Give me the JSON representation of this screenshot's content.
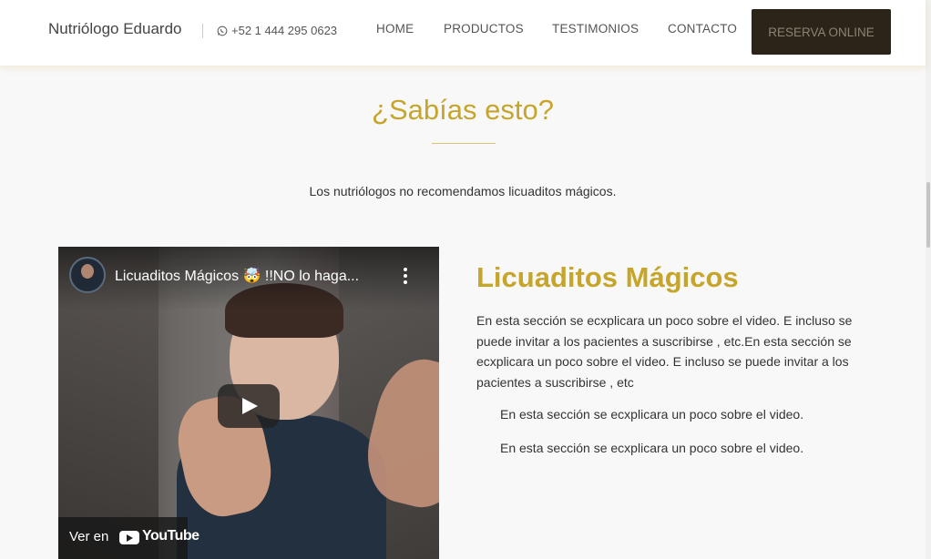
{
  "header": {
    "brand": "Nutriólogo Eduardo",
    "phone": "+52 1 444 295 0623",
    "nav": {
      "home": "HOME",
      "productos": "PRODUCTOS",
      "testimonios": "TESTIMONIOS",
      "contacto": "CONTACTO"
    },
    "cta": "RESERVA ONLINE"
  },
  "section": {
    "title": "¿Sabías esto?",
    "intro": "Los nutriólogos no recomendamos licuaditos mágicos."
  },
  "video": {
    "title": "Licuaditos Mágicos 🤯 !!NO lo haga...",
    "watch_on": "Ver en",
    "youtube": "YouTube"
  },
  "content": {
    "title": "Licuaditos Mágicos",
    "paragraph": "En esta sección se ecxplicara un poco sobre el video. E incluso se puede invitar a los pacientes a suscribirse , etc.En esta sección se ecxplicara un poco sobre el video. E incluso se puede invitar a los pacientes a suscribirse , etc",
    "line_1": "En esta sección se ecxplicara un poco sobre el video.",
    "line_2": "En esta sección se ecxplicara un poco sobre el video."
  },
  "colors": {
    "accent": "#c6a52b",
    "cta_bg": "#2b2519"
  }
}
